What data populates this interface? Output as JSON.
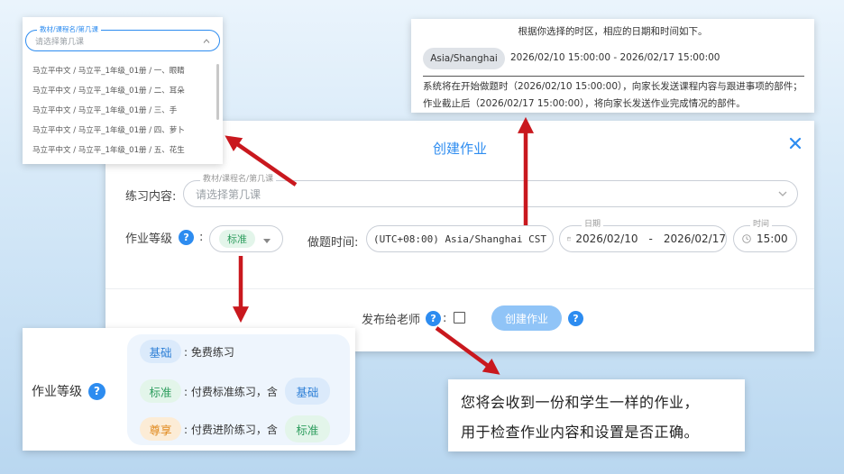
{
  "dialog": {
    "title": "创建作业",
    "close_icon": "close-icon",
    "practice_label": "练习内容:",
    "practice_float_label": "教材/课程名/第几课",
    "practice_placeholder": "请选择第几课",
    "level_label": "作业等级",
    "level_colon": ":",
    "help_glyph": "?",
    "level_value": "标准",
    "time_label": "做题时间:",
    "timezone_value": "(UTC+08:00) Asia/Shanghai CST",
    "date_float_label": "日期",
    "date_start": "2026/02/10",
    "date_sep": "-",
    "date_end": "2026/02/17",
    "time_float_label": "时间",
    "time_value": "15:00",
    "publish_label": "发布给老师",
    "create_button": "创建作业",
    "accent_color": "#2d8cf0"
  },
  "dropdown": {
    "float_label": "教材/课程名/第几课",
    "placeholder": "请选择第几课",
    "items": [
      "马立平中文 / 马立平_1年级_01册 / 一、眼睛",
      "马立平中文 / 马立平_1年级_01册 / 二、耳朵",
      "马立平中文 / 马立平_1年级_01册 / 三、手",
      "马立平中文 / 马立平_1年级_01册 / 四、萝卜",
      "马立平中文 / 马立平_1年级_01册 / 五、花生"
    ]
  },
  "timezone_info": {
    "heading": "根据你选择的时区，相应的日期和时间如下。",
    "zone": "Asia/Shanghai",
    "range": "2026/02/10 15:00:00 - 2026/02/17 15:00:00",
    "note_line1": "系统将在开始做题时（2026/02/10 15:00:00），向家长发送课程内容与跟进事项的部件；",
    "note_line2": "作业截止后（2026/02/17 15:00:00），将向家长发送作业完成情况的部件。"
  },
  "tiers": {
    "label": "作业等级",
    "help_glyph": "?",
    "rows": [
      {
        "tier": "基础",
        "desc": ": 免费练习",
        "includes": ""
      },
      {
        "tier": "标准",
        "desc": ": 付费标准练习，含",
        "includes": "基础"
      },
      {
        "tier": "尊享",
        "desc": ": 付费进阶练习，含",
        "includes": "标准"
      }
    ]
  },
  "note": {
    "line1": "您将会收到一份和学生一样的作业，",
    "line2": "用于检查作业内容和设置是否正确。"
  },
  "arrow_color": "#c9181e"
}
